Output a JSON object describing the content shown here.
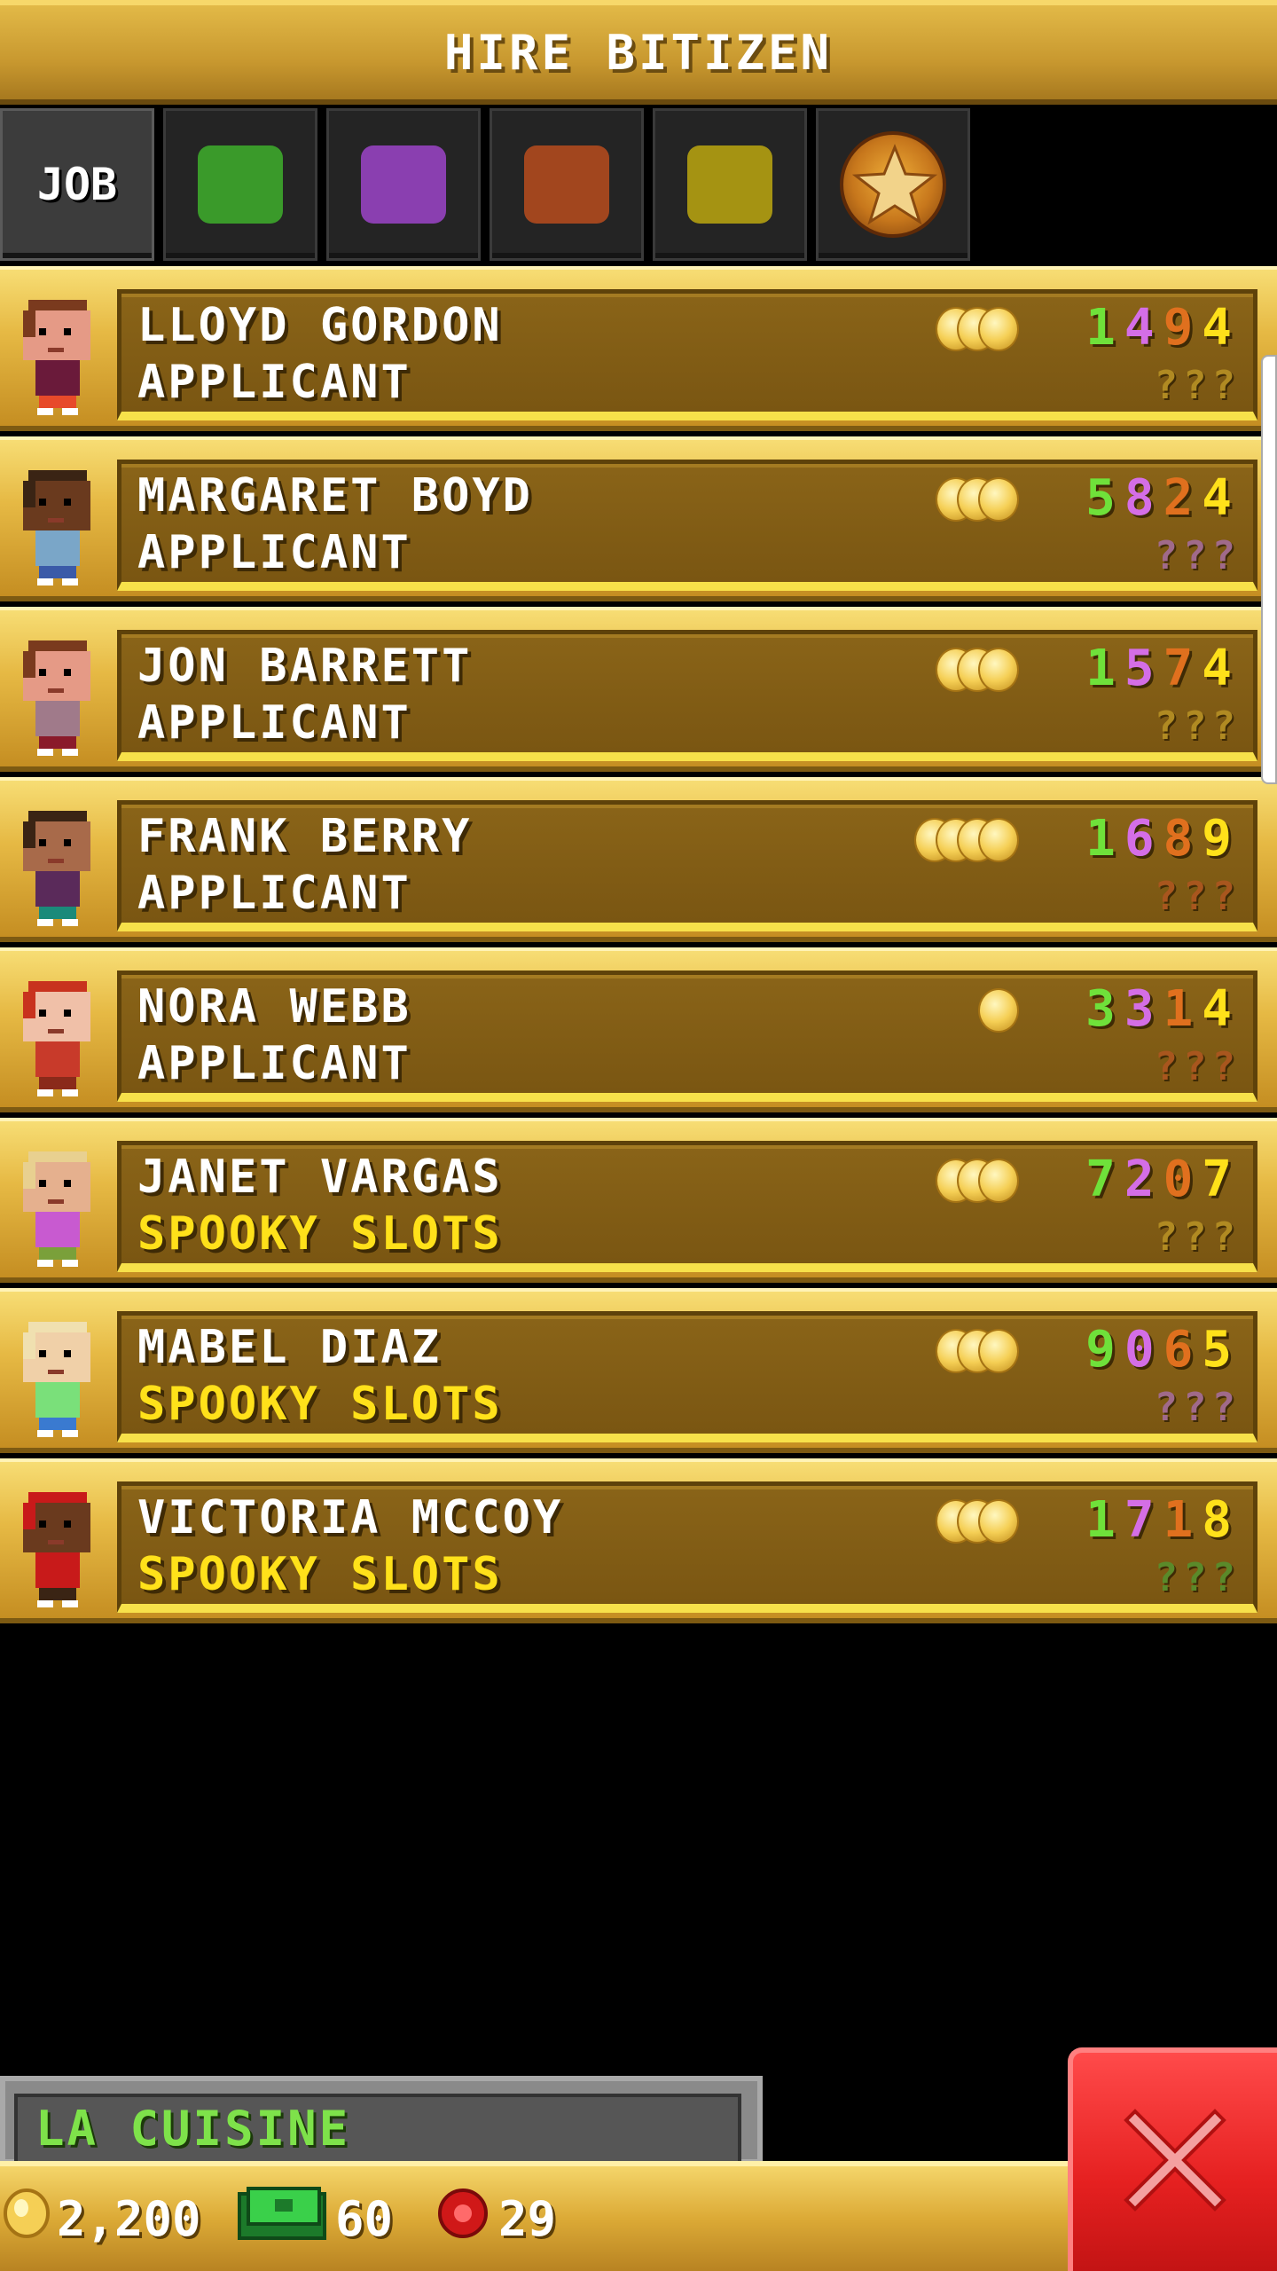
{
  "header": {
    "title": "HIRE BITIZEN"
  },
  "tabs": [
    {
      "id": "job",
      "label": "JOB",
      "active": true
    },
    {
      "id": "food",
      "color": "#3a9a2a"
    },
    {
      "id": "service",
      "color": "#8a3fb0"
    },
    {
      "id": "recreation",
      "color": "#a2461e"
    },
    {
      "id": "retail",
      "color": "#a59312"
    },
    {
      "id": "creative",
      "icon": "star-icon"
    }
  ],
  "bitizens": [
    {
      "name": "LLOYD GORDON",
      "job": "APPLICANT",
      "job_color": "white",
      "coins": 3,
      "stats": [
        "1",
        "4",
        "9",
        "4"
      ],
      "stat_colors": [
        "#6fe13a",
        "#d46ee6",
        "#e0701e",
        "#ffe11a"
      ],
      "unknown": "???",
      "unknown_color": "#b08a22",
      "skin": "#e59a86",
      "hair": "#7a3a1e",
      "shirt": "#6a1a3a",
      "pants": "#e74a2a"
    },
    {
      "name": "MARGARET BOYD",
      "job": "APPLICANT",
      "job_color": "white",
      "coins": 3,
      "stats": [
        "5",
        "8",
        "2",
        "4"
      ],
      "stat_colors": [
        "#6fe13a",
        "#d46ee6",
        "#e0701e",
        "#ffe11a"
      ],
      "unknown": "???",
      "unknown_color": "#a06a8a",
      "skin": "#6a3a1e",
      "hair": "#3a2414",
      "shirt": "#7aa6c8",
      "pants": "#3a5aa8"
    },
    {
      "name": "JON BARRETT",
      "job": "APPLICANT",
      "job_color": "white",
      "coins": 3,
      "stats": [
        "1",
        "5",
        "7",
        "4"
      ],
      "stat_colors": [
        "#6fe13a",
        "#d46ee6",
        "#e0701e",
        "#ffe11a"
      ],
      "unknown": "???",
      "unknown_color": "#b08a22",
      "skin": "#e59a86",
      "hair": "#7a3a1e",
      "shirt": "#a07a8a",
      "pants": "#8a1a2a"
    },
    {
      "name": "FRANK BERRY",
      "job": "APPLICANT",
      "job_color": "white",
      "coins": 4,
      "stats": [
        "1",
        "6",
        "8",
        "9"
      ],
      "stat_colors": [
        "#6fe13a",
        "#d46ee6",
        "#e0701e",
        "#ffe11a"
      ],
      "unknown": "???",
      "unknown_color": "#a8561e",
      "skin": "#a86a4a",
      "hair": "#3a2414",
      "shirt": "#5a2a5a",
      "pants": "#1a8a7a"
    },
    {
      "name": "NORA WEBB",
      "job": "APPLICANT",
      "job_color": "white",
      "coins": 1,
      "stats": [
        "3",
        "3",
        "1",
        "4"
      ],
      "stat_colors": [
        "#6fe13a",
        "#d46ee6",
        "#e0701e",
        "#ffe11a"
      ],
      "unknown": "???",
      "unknown_color": "#a8561e",
      "skin": "#f0c0a8",
      "hair": "#c8321e",
      "shirt": "#c83a2a",
      "pants": "#8a2a1a"
    },
    {
      "name": "JANET VARGAS",
      "job": "SPOOKY SLOTS",
      "job_color": "yellow",
      "coins": 3,
      "stats": [
        "7",
        "2",
        "0",
        "7"
      ],
      "stat_colors": [
        "#6fe13a",
        "#d46ee6",
        "#e0701e",
        "#ffe11a"
      ],
      "unknown": "???",
      "unknown_color": "#b08a22",
      "skin": "#e5b08e",
      "hair": "#e8d090",
      "shirt": "#c85ad0",
      "pants": "#7aa03a"
    },
    {
      "name": "MABEL DIAZ",
      "job": "SPOOKY SLOTS",
      "job_color": "yellow",
      "coins": 3,
      "stats": [
        "9",
        "0",
        "6",
        "5"
      ],
      "stat_colors": [
        "#6fe13a",
        "#d46ee6",
        "#e0701e",
        "#ffe11a"
      ],
      "unknown": "???",
      "unknown_color": "#a06a8a",
      "skin": "#f0d0a8",
      "hair": "#f0e0b0",
      "shirt": "#7ae07a",
      "pants": "#3a7ad0"
    },
    {
      "name": "VICTORIA MCCOY",
      "job": "SPOOKY SLOTS",
      "job_color": "yellow",
      "coins": 3,
      "stats": [
        "1",
        "7",
        "1",
        "8"
      ],
      "stat_colors": [
        "#6fe13a",
        "#d46ee6",
        "#e0701e",
        "#ffe11a"
      ],
      "unknown": "???",
      "unknown_color": "#5a8a2a",
      "skin": "#6a3a1e",
      "hair": "#c81a1a",
      "shirt": "#c81a1a",
      "pants": "#3a2414"
    }
  ],
  "building": {
    "name": "LA CUISINE"
  },
  "currency": {
    "coins": "2,200",
    "bux": "60",
    "tickets": "29"
  },
  "close": {
    "icon": "close-icon"
  }
}
